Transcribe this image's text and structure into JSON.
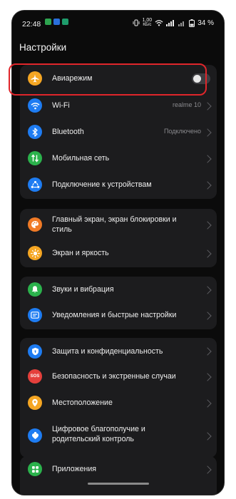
{
  "status_bar": {
    "time": "22:48",
    "network_speed_value": "1,00",
    "network_speed_unit": "КБ/с",
    "battery_text": "34 %",
    "app_icon_colors": [
      "#2ea44f",
      "#2a6fdb",
      "#1e9c6b"
    ]
  },
  "header": {
    "title": "Настройки"
  },
  "groups": [
    {
      "items": [
        {
          "label": "Авиарежим",
          "icon": "airplane-icon",
          "icon_color": "#f5a623",
          "control": "toggle",
          "toggle_on": false
        },
        {
          "label": "Wi-Fi",
          "value": "realme 10",
          "icon": "wifi-icon",
          "icon_color": "#1e7cf2"
        },
        {
          "label": "Bluetooth",
          "value": "Подключено",
          "icon": "bluetooth-icon",
          "icon_color": "#1e7cf2"
        },
        {
          "label": "Мобильная сеть",
          "icon": "mobile-network-icon",
          "icon_color": "#2bb24c"
        },
        {
          "label": "Подключение к устройствам",
          "icon": "device-connection-icon",
          "icon_color": "#1e7cf2"
        }
      ]
    },
    {
      "items": [
        {
          "label": "Главный экран, экран блокировки и стиль",
          "icon": "palette-icon",
          "icon_color": "#f07a26"
        },
        {
          "label": "Экран и яркость",
          "icon": "brightness-icon",
          "icon_color": "#f5a623"
        }
      ]
    },
    {
      "items": [
        {
          "label": "Звуки и вибрация",
          "icon": "bell-icon",
          "icon_color": "#2bb24c"
        },
        {
          "label": "Уведомления и быстрые настройки",
          "icon": "notifications-icon",
          "icon_color": "#1e7cf2"
        }
      ]
    },
    {
      "items": [
        {
          "label": "Защита и конфиденциальность",
          "icon": "shield-icon",
          "icon_color": "#1e7cf2"
        },
        {
          "label": "Безопасность и экстренные случаи",
          "icon": "sos-icon",
          "icon_color": "#e5403c",
          "icon_text": "SOS"
        },
        {
          "label": "Местоположение",
          "icon": "location-icon",
          "icon_color": "#f5a623"
        },
        {
          "label": "Цифровое благополучие и родительский контроль",
          "icon": "wellbeing-icon",
          "icon_color": "#1e7cf2"
        }
      ]
    },
    {
      "items": [
        {
          "label": "Приложения",
          "icon": "apps-icon",
          "icon_color": "#2bb24c"
        }
      ]
    }
  ]
}
